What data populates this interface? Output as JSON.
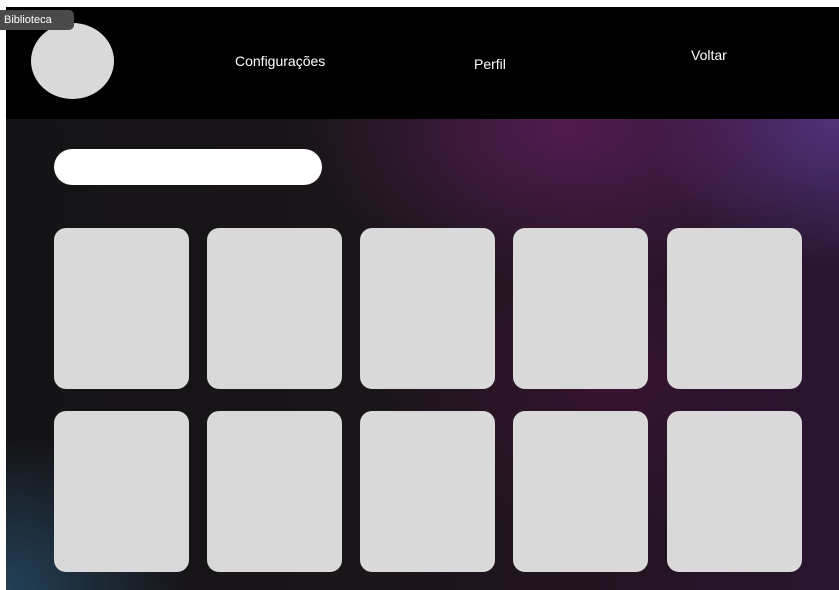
{
  "frame": {
    "label": "Biblioteca"
  },
  "header": {
    "nav": {
      "settings_label": "Configurações",
      "profile_label": "Perfil",
      "back_label": "Voltar"
    }
  },
  "search": {
    "value": "",
    "placeholder": ""
  },
  "grid": {
    "rows": 2,
    "columns": 5,
    "cards": [
      "",
      "",
      "",
      "",
      "",
      "",
      "",
      "",
      "",
      ""
    ]
  },
  "colors": {
    "header_background": "#000000",
    "placeholder_gray": "#d9d9d9",
    "text": "#ffffff",
    "gradient_purple": "#5a2a6e",
    "gradient_blue": "#284e6a"
  }
}
